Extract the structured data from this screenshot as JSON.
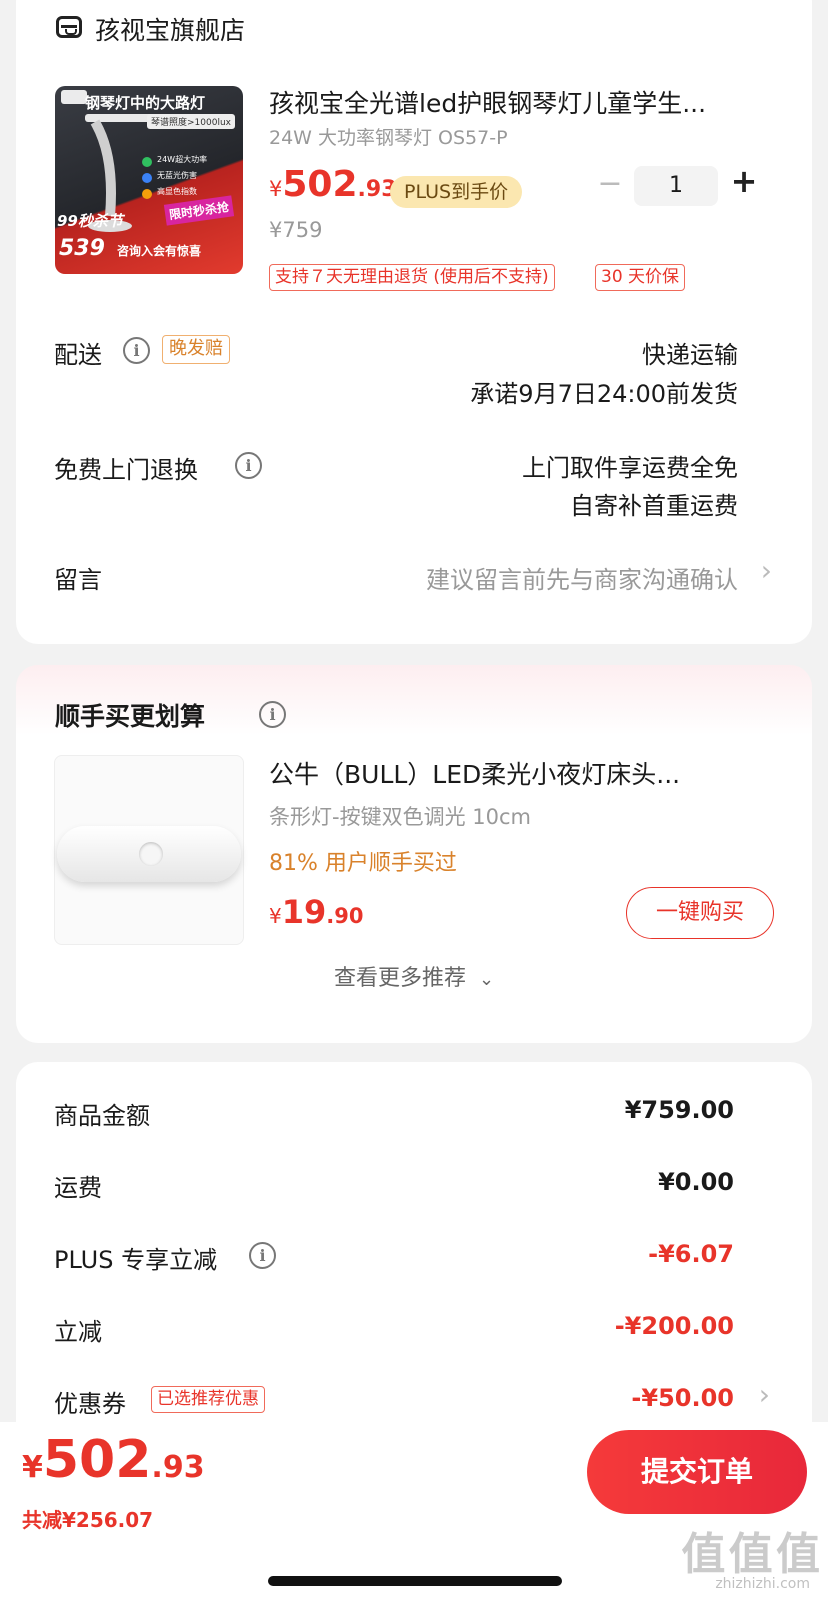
{
  "store": {
    "name": "孩视宝旗舰店"
  },
  "product": {
    "title": "孩视宝全光谱led护眼钢琴灯儿童学生...",
    "spec": "24W 大功率钢琴灯 OS57-P",
    "price_symbol": "¥",
    "price_int": "502",
    "price_dec": ".93",
    "plus_badge": "PLUS到手价",
    "original_price": "¥759",
    "quantity": "1",
    "minus": "−",
    "plus": "+",
    "tags": [
      "支持７天无理由退货 (使用后不支持)",
      "30 天价保"
    ],
    "image": {
      "headline": "钢琴灯中的大路灯",
      "sub": "琴谱照度>1000lux",
      "features": [
        "24W超大功率",
        "无蓝光伤害",
        "高显色指数"
      ],
      "promo_left": "99秒杀节",
      "promo_right": "限时秒杀抢",
      "price_tag": "539",
      "consult": "咨询入会有惊喜"
    }
  },
  "delivery": {
    "label": "配送",
    "tag": "晚发赔",
    "method": "快递运输",
    "promise": "承诺9月7日24:00前发货"
  },
  "return_service": {
    "label": "免费上门退换",
    "line1": "上门取件享运费全免",
    "line2": "自寄补首重运费"
  },
  "message": {
    "label": "留言",
    "placeholder": "建议留言前先与商家沟通确认"
  },
  "addon": {
    "section_title": "顺手买更划算",
    "title": "公牛（BULL）LED柔光小夜灯床头...",
    "spec": "条形灯-按键双色调光 10cm",
    "stat": "81% 用户顺手买过",
    "price_symbol": "¥",
    "price_int": "19",
    "price_dec": ".90",
    "buy_button": "一键购买",
    "more": "查看更多推荐"
  },
  "summary": {
    "rows": [
      {
        "label": "商品金额",
        "value": "¥759.00"
      },
      {
        "label": "运费",
        "value": "¥0.00"
      },
      {
        "label": "PLUS 专享立减",
        "value": "-¥6.07"
      },
      {
        "label": "立减",
        "value": "-¥200.00"
      },
      {
        "label": "优惠券",
        "value": "-¥50.00",
        "tag": "已选推荐优惠"
      }
    ]
  },
  "footer": {
    "price_symbol": "¥",
    "price_int": "502",
    "price_dec": ".93",
    "saved": "共减¥256.07",
    "submit": "提交订单"
  },
  "watermark": "值 值 值",
  "watermark_url": "zhizhizhi.com",
  "colors": {
    "accent": "#e8342a",
    "plus_bg": "#fbe7b0",
    "orange": "#d9822b"
  }
}
